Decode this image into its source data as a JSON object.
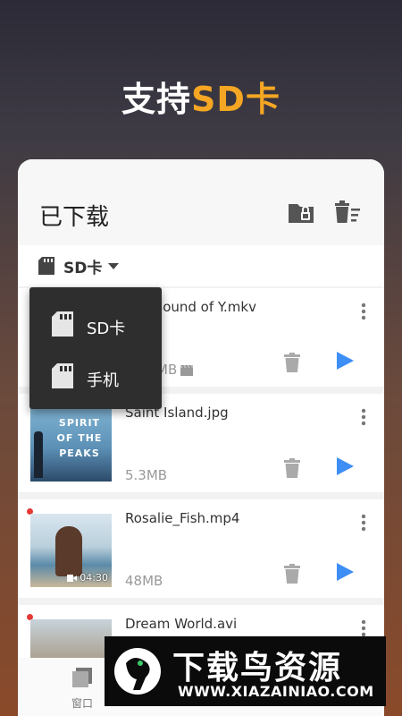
{
  "hero": {
    "prefix": "支持",
    "accent": "SD卡"
  },
  "colors": {
    "accent": "#f5a623",
    "play": "#3d8ef5",
    "new_dot": "#e53935"
  },
  "card": {
    "title": "已下载",
    "icons": [
      "locked-folder-icon",
      "delete-list-icon"
    ],
    "storage": {
      "label": "SD卡",
      "icon": "sd-card-icon"
    }
  },
  "dropdown": {
    "items": [
      {
        "label": "SD卡",
        "icon": "sd-card-icon"
      },
      {
        "label": "手机",
        "icon": "sd-card-icon"
      }
    ]
  },
  "files": [
    {
      "name": "The Sound of Y.mkv",
      "size": "MB",
      "new": false
    },
    {
      "name": "Saint Island.jpg",
      "size": "5.3MB",
      "new": false,
      "thumb_text": "SPIRIT OF THE PEAKS"
    },
    {
      "name": "Rosalie_Fish.mp4",
      "size": "48MB",
      "new": true,
      "duration": "04:30"
    },
    {
      "name": "Dream World.avi",
      "size": "",
      "new": true
    }
  ],
  "bottom_nav": {
    "left_label": "窗口"
  },
  "watermark": {
    "title": "下载鸟资源",
    "url": "WWW.XIAZAINIAO.COM"
  }
}
